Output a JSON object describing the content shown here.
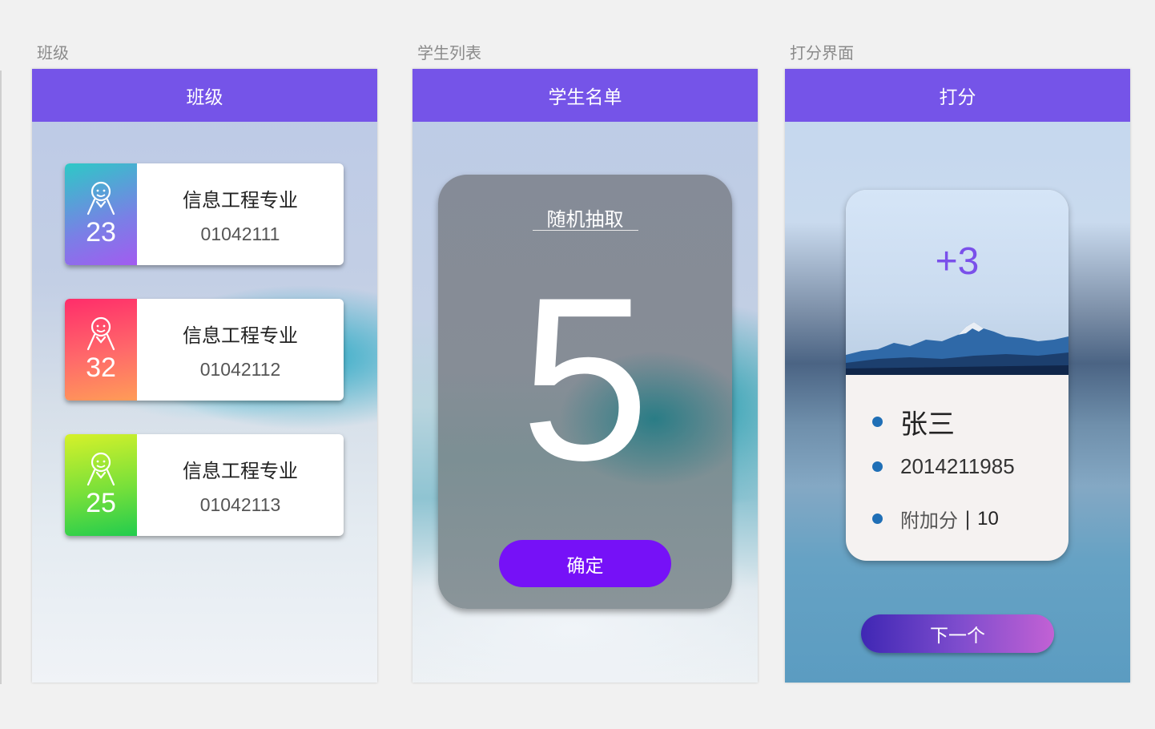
{
  "frames": [
    {
      "caption": "班级",
      "nav_title": "班级"
    },
    {
      "caption": "学生列表",
      "nav_title": "学生名单"
    },
    {
      "caption": "打分界面",
      "nav_title": "打分"
    }
  ],
  "classes": [
    {
      "count": "23",
      "name": "信息工程专业",
      "code": "01042111",
      "icon": "person-icon",
      "gradient": [
        "#2dc9c6",
        "#a25bf0"
      ]
    },
    {
      "count": "32",
      "name": "信息工程专业",
      "code": "01042112",
      "icon": "person-icon",
      "gradient": [
        "#ff2d6a",
        "#ff9c57"
      ]
    },
    {
      "count": "25",
      "name": "信息工程专业",
      "code": "01042113",
      "icon": "person-icon",
      "gradient": [
        "#d6f12a",
        "#22cc4e"
      ]
    }
  ],
  "draw": {
    "title": "随机抽取",
    "number": "5",
    "confirm_label": "确定"
  },
  "score": {
    "value": "+3",
    "student_name": "张三",
    "student_id": "2014211985",
    "bonus_label": "附加分",
    "bonus_separator": "|",
    "bonus_value": "10",
    "next_label": "下一个"
  },
  "colors": {
    "nav": "#7554e8",
    "confirm_button": "#7611f7",
    "score_text": "#7a50ea",
    "bullet": "#1f6fb6"
  }
}
